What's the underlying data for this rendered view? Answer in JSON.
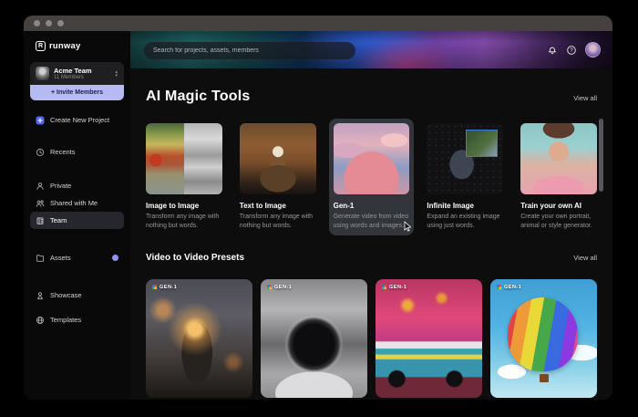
{
  "colors": {
    "accent": "#b5b9f4",
    "assets_badge": "#8f92ee",
    "selected_nav_bg": "#26272c"
  },
  "sidebar": {
    "logo": "runway",
    "team_name": "Acme Team",
    "team_members": "11 Members",
    "invite_label": "+ Invite Members",
    "create_label": "Create New Project",
    "items": [
      {
        "label": "Recents",
        "icon": "clock-icon"
      },
      {
        "label": "Private",
        "icon": "person-icon"
      },
      {
        "label": "Shared with Me",
        "icon": "people-icon"
      },
      {
        "label": "Team",
        "icon": "building-icon",
        "selected": true
      },
      {
        "label": "Assets",
        "icon": "folder-icon",
        "has_badge": true
      },
      {
        "label": "Showcase",
        "icon": "showcase-icon"
      },
      {
        "label": "Templates",
        "icon": "globe-icon"
      }
    ]
  },
  "header": {
    "search_placeholder": "Search for projects, assets, members"
  },
  "magic_tools": {
    "title": "AI Magic Tools",
    "view_all": "View all",
    "cards": [
      {
        "title": "Image to Image",
        "desc": "Transform any image with nothing but words."
      },
      {
        "title": "Text to Image",
        "desc": "Transform any image with nothing but words."
      },
      {
        "title": "Gen-1",
        "desc": "Generate video from video using words and images.",
        "highlighted": true
      },
      {
        "title": "Infinite Image",
        "desc": "Expand an existing image using just words."
      },
      {
        "title": "Train your own AI",
        "desc": "Create your own portrait, animal or style generator."
      }
    ]
  },
  "presets": {
    "title": "Video to Video Presets",
    "view_all": "View all",
    "cards": [
      {
        "badge": "GEN-1"
      },
      {
        "badge": "GEN-1"
      },
      {
        "badge": "GEN-1"
      },
      {
        "badge": "GEN-1"
      }
    ]
  }
}
